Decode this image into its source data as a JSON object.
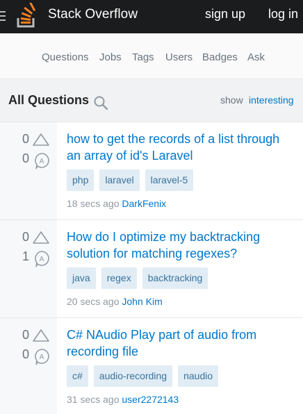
{
  "header": {
    "brand": "Stack Overflow",
    "signup": "sign up",
    "login": "log in"
  },
  "nav": {
    "items": [
      "Questions",
      "Jobs",
      "Tags",
      "Users",
      "Badges",
      "Ask"
    ]
  },
  "section": {
    "title": "All Questions",
    "show_label": "show",
    "show_filter": "interesting"
  },
  "questions": [
    {
      "votes": "0",
      "answers": "0",
      "title": "how to get the records of a list through an array of id's Laravel",
      "tags": [
        "php",
        "laravel",
        "laravel-5"
      ],
      "time": "18 secs ago",
      "user": "DarkFenix"
    },
    {
      "votes": "0",
      "answers": "1",
      "title": "How do I optimize my backtracking solution for matching regexes?",
      "tags": [
        "java",
        "regex",
        "backtracking"
      ],
      "time": "20 secs ago",
      "user": "John Kim"
    },
    {
      "votes": "0",
      "answers": "0",
      "title": "C# NAudio Play part of audio from recording file",
      "tags": [
        "c#",
        "audio-recording",
        "naudio"
      ],
      "time": "31 secs ago",
      "user": "user2272143"
    }
  ],
  "colors": {
    "topbar": "#1b1c1d",
    "link": "#0077cc",
    "tag_bg": "#e1ecf4",
    "tag_text": "#39739d",
    "logo_orange": "#f48024"
  },
  "icons": [
    "hamburger-icon",
    "stack-overflow-logo",
    "search-icon",
    "vote-up-icon",
    "answer-bubble-icon"
  ]
}
